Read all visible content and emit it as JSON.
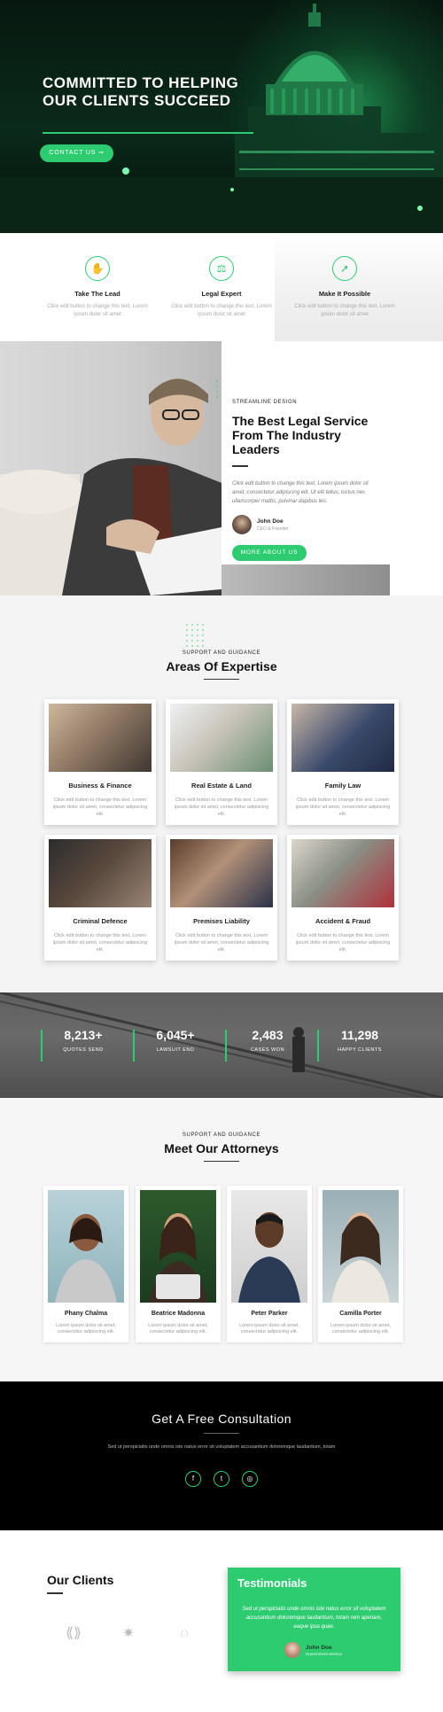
{
  "hero": {
    "title": "COMMITTED TO HELPING OUR CLIENTS SUCCEED",
    "button": "CONTACT US ➞"
  },
  "features": [
    {
      "icon": "hand-icon",
      "title": "Take The Lead",
      "desc": "Click edit button to change this text. Lorem ipsum dolor sit amet"
    },
    {
      "icon": "gavel-icon",
      "title": "Legal Expert",
      "desc": "Click edit button to change this text. Lorem ipsum dolor sit amet"
    },
    {
      "icon": "rocket-icon",
      "title": "Make It Possible",
      "desc": "Click edit button to change this text. Lorem ipsum dolor sit amet"
    }
  ],
  "about": {
    "eyebrow": "STREAMLINE DESIGN",
    "title": "The Best Legal Service From The Industry Leaders",
    "desc": "Click edit button to change this text. Lorem ipsum dolor sit amet, consectetur adipiscing elit. Ut elit tellus, luctus nec ullamcorper mattis, pulvinar dapibus leo.",
    "person_name": "John Doe",
    "person_role": "CEO & Founder",
    "button": "MORE ABOUT US"
  },
  "expertise": {
    "eyebrow": "SUPPORT AND GUIDANCE",
    "title": "Areas Of Expertise",
    "items": [
      {
        "title": "Business & Finance",
        "desc": "Click edit button to change this text. Lorem ipsum dolor sit amet, consectetur adipiscing elit."
      },
      {
        "title": "Real Estate & Land",
        "desc": "Click edit button to change this text. Lorem ipsum dolor sit amet, consectetur adipiscing elit."
      },
      {
        "title": "Family Law",
        "desc": "Click edit button to change this text. Lorem ipsum dolor sit amet, consectetur adipiscing elit."
      },
      {
        "title": "Criminal Defence",
        "desc": "Click edit button to change this text. Lorem ipsum dolor sit amet, consectetur adipiscing elit."
      },
      {
        "title": "Premises Liability",
        "desc": "Click edit button to change this text. Lorem ipsum dolor sit amet, consectetur adipiscing elit."
      },
      {
        "title": "Accident & Fraud",
        "desc": "Click edit button to change this text. Lorem ipsum dolor sit amet, consectetur adipiscing elit."
      }
    ]
  },
  "stats": [
    {
      "num": "8,213+",
      "label": "QUOTES SEND"
    },
    {
      "num": "6,045+",
      "label": "LAWSUIT END"
    },
    {
      "num": "2,483",
      "label": "CASES WON"
    },
    {
      "num": "11,298",
      "label": "HAPPY CLIENTS"
    }
  ],
  "attorneys": {
    "eyebrow": "SUPPORT AND GUIDANCE",
    "title": "Meet Our Attorneys",
    "items": [
      {
        "name": "Phany Chalma",
        "desc": "Lorem ipsum dolor sit amet, consectetur adipiscing elit."
      },
      {
        "name": "Beatrice Madonna",
        "desc": "Lorem ipsum dolor sit amet, consectetur adipiscing elit."
      },
      {
        "name": "Peter Parker",
        "desc": "Lorem ipsum dolor sit amet, consectetur adipiscing elit."
      },
      {
        "name": "Camilla Porter",
        "desc": "Lorem ipsum dolor sit amet, consectetur adipiscing elit."
      }
    ]
  },
  "consult": {
    "title": "Get A Free Consultation",
    "desc": "Sed ut perspiciatis unde omnis iste natus error sit voluptatem accusantium doloremque laudantium, totam",
    "socials": [
      "facebook-icon",
      "twitter-icon",
      "instagram-icon"
    ]
  },
  "clients": {
    "title": "Our Clients"
  },
  "testimonial": {
    "title": "Testimonials",
    "quote": "Sed ut perspiciatis unde omnis iste natus error sit voluptatem accusantium doloremque laudantium, totam rem aperiam, eaque ipsa quae.",
    "name": "John Doe",
    "role": "Government Service"
  },
  "colors": {
    "accent": "#2ecc71",
    "dark": "#000000"
  }
}
